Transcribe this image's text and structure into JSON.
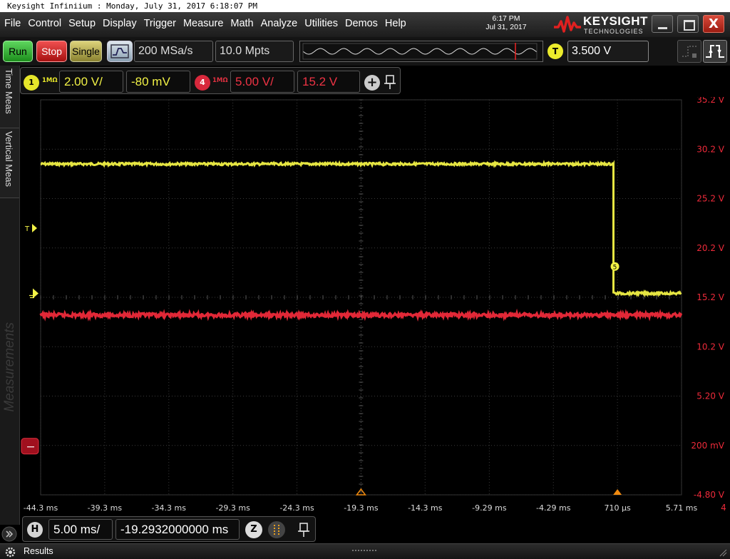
{
  "window": {
    "title": "Keysight Infiniium : Monday, July 31, 2017 6:18:07 PM"
  },
  "menu": {
    "items": [
      "File",
      "Control",
      "Setup",
      "Display",
      "Trigger",
      "Measure",
      "Math",
      "Analyze",
      "Utilities",
      "Demos",
      "Help"
    ],
    "clock_time": "6:17 PM",
    "clock_date": "Jul 31, 2017",
    "logo_name": "KEYSIGHT",
    "logo_sub": "TECHNOLOGIES",
    "close_glyph": "X"
  },
  "toolbar": {
    "run_label": "Run",
    "stop_label": "Stop",
    "single_label": "Single",
    "sample_rate": "200 MSa/s",
    "memory_depth": "10.0 Mpts",
    "trigger_badge": "T",
    "trigger_level": "3.500 V"
  },
  "channels": {
    "ch1": {
      "number": "1",
      "impedance": "1MΩ",
      "scale": "2.00 V/",
      "offset": "-80 mV",
      "color": "#f2f246"
    },
    "ch4": {
      "number": "4",
      "impedance": "1MΩ",
      "scale": "5.00 V/",
      "offset": "15.2 V",
      "color": "#ee3344"
    },
    "add_glyph": "+"
  },
  "sidebar": {
    "tab_time": "Time Meas",
    "tab_vertical": "Vertical Meas",
    "measurements": "Measurements"
  },
  "horizontal": {
    "badge": "H",
    "scale": "5.00 ms/",
    "position": "-19.2932000000 ms",
    "zoom_badge": "Z"
  },
  "results": {
    "label": "Results"
  },
  "chart_data": {
    "type": "line",
    "grid": true,
    "x_ticks": [
      "-44.3 ms",
      "-39.3 ms",
      "-34.3 ms",
      "-29.3 ms",
      "-24.3 ms",
      "-19.3 ms",
      "-14.3 ms",
      "-9.29 ms",
      "-4.29 ms",
      "710 µs",
      "5.71 ms"
    ],
    "x_tick_values": [
      -44.3,
      -39.3,
      -34.3,
      -29.3,
      -24.3,
      -19.3,
      -14.3,
      -9.29,
      -4.29,
      0.71,
      5.71
    ],
    "xlim": [
      -44.3,
      5.71
    ],
    "y_ticks": [
      "35.2 V",
      "30.2 V",
      "25.2 V",
      "20.2 V",
      "15.2 V",
      "10.2 V",
      "5.20 V",
      "200 mV",
      "-4.80 V"
    ],
    "y_tick_values": [
      35.2,
      30.2,
      25.2,
      20.2,
      15.2,
      10.2,
      5.2,
      0.2,
      -4.8
    ],
    "ylim": [
      -4.8,
      35.2
    ],
    "overflow_label": "4",
    "marker_label": "5",
    "series": [
      {
        "channel": "1",
        "color": "#f2f246",
        "x": [
          -44.3,
          0.4,
          0.4,
          5.71
        ],
        "y": [
          28.7,
          28.7,
          15.6,
          15.6
        ]
      },
      {
        "channel": "4",
        "color": "#ee2a3a",
        "x": [
          -44.3,
          5.71
        ],
        "y": [
          13.4,
          13.4
        ]
      }
    ]
  }
}
